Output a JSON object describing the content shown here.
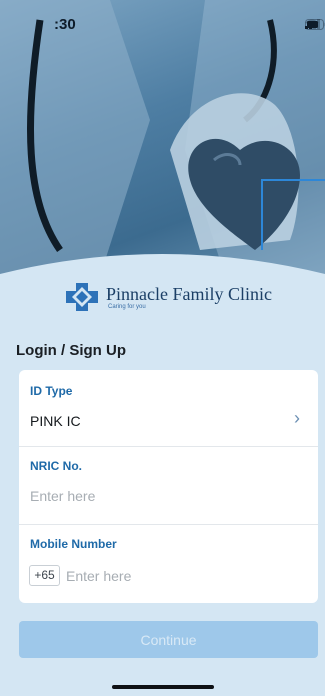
{
  "status_bar": {
    "time": ":30"
  },
  "brand": {
    "name": "Pinnacle Family Clinic",
    "tagline": "Caring for you",
    "colors": {
      "primary": "#1f6aa8",
      "logo_blue": "#2d72b8"
    }
  },
  "form": {
    "heading": "Login / Sign Up",
    "id_type": {
      "label": "ID Type",
      "value": "PINK IC"
    },
    "nric": {
      "label": "NRIC No.",
      "placeholder": "Enter here"
    },
    "mobile": {
      "label": "Mobile Number",
      "country_code": "+65",
      "placeholder": "Enter here"
    },
    "continue_label": "Continue"
  }
}
